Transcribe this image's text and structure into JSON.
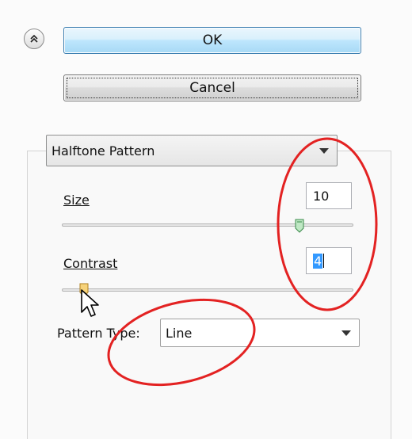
{
  "dialog": {
    "ok_label": "OK",
    "cancel_label": "Cancel"
  },
  "filter": {
    "selected": "Halftone Pattern"
  },
  "size": {
    "label": "Size",
    "value": "10",
    "slider_fraction": 0.83
  },
  "contrast": {
    "label": "Contrast",
    "value": "4",
    "slider_fraction": 0.07
  },
  "pattern_type": {
    "label": "Pattern Type:",
    "selected": "Line"
  },
  "colors": {
    "annotation": "#e32222",
    "ok_border": "#3c7fb1",
    "selection": "#3399ff"
  }
}
